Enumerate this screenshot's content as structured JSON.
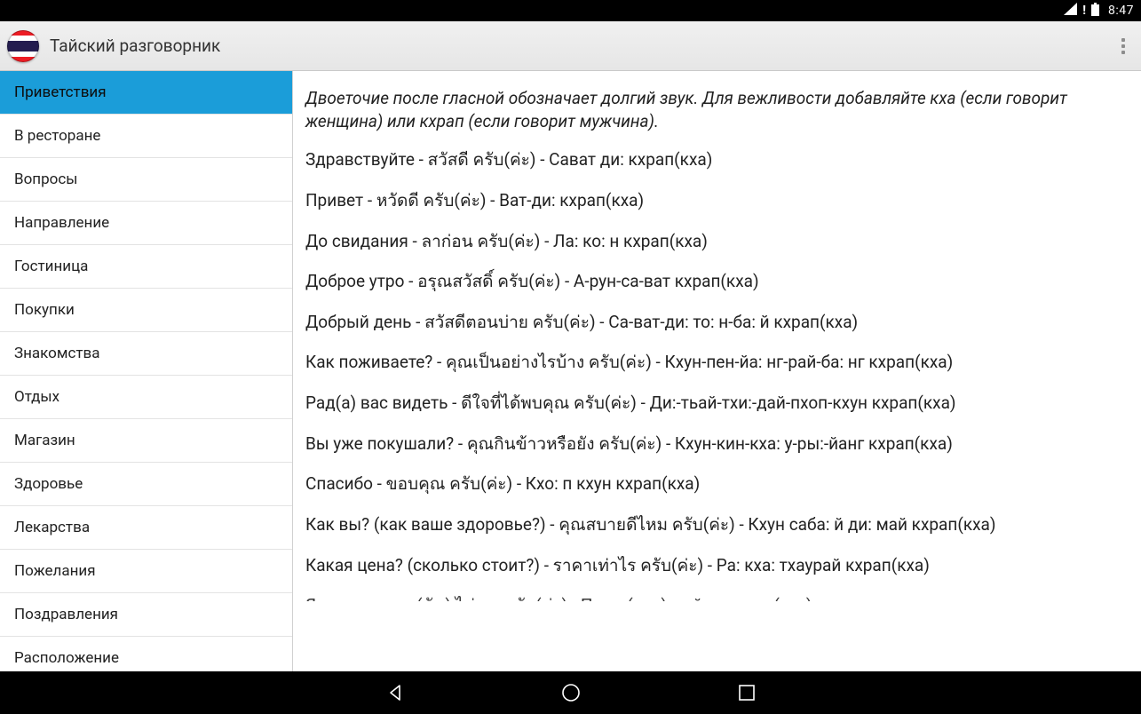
{
  "statusbar": {
    "time": "8:47"
  },
  "actionbar": {
    "title": "Тайский разговорник"
  },
  "sidebar": {
    "selected_index": 0,
    "items": [
      "Приветствия",
      "В ресторане",
      "Вопросы",
      "Направление",
      "Гостиница",
      "Покупки",
      "Знакомства",
      "Отдых",
      "Магазин",
      "Здоровье",
      "Лекарства",
      "Пожелания",
      "Поздравления",
      "Расположение"
    ]
  },
  "content": {
    "intro": "Двоеточие после гласной обозначает долгий звук. Для вежливости добавляйте кха (если говорит женщина) или кхрап (если говорит мужчина).",
    "phrases": [
      "Здравствуйте - สวัสดี ครับ(ค่ะ) - Сават ди: кхрап(кха)",
      "Привет - หวัดดี ครับ(ค่ะ) - Ват-ди: кхрап(кха)",
      "До свидания - ลาก่อน ครับ(ค่ะ) - Ла: ко: н кхрап(кха)",
      "Доброе утро - อรุณสวัสดิ์ ครับ(ค่ะ) - А-рун-са-ват кхрап(кха)",
      "Добрый день - สวัสดีตอนบ่าย ครับ(ค่ะ) - Са-ват-ди: то: н-ба: й кхрап(кха)",
      "Как поживаете? - คุณเป็นอย่างไรบ้าง ครับ(ค่ะ) - Кхун-пен-йа: нг-рай-ба: нг кхрап(кха)",
      "Рад(а) вас видеть - ดีใจที่ได้พบคุณ ครับ(ค่ะ) - Ди:-тьай-тхи:-дай-пхоп-кхун кхрап(кха)",
      "Вы уже покушали? - คุณกินข้าวหรือยัง ครับ(ค่ะ) - Кхун-кин-кха: у-ры:-йанг кхрап(кха)",
      "Спасибо - ขอบคุณ ครับ(ค่ะ) - Кхо: п кхун кхрап(кха)",
      "Как вы? (как ваше здоровье?) - คุณสบายดีไหม ครับ(ค่ะ) - Кхун саба: й ди: май кхрап(кха)",
      "Какая цена? (сколько стоит?) - ราคาเท่าไร ครับ(ค่ะ) - Ра: кха: тхаурай кхрап(кха)",
      "Я не хочу -  ผม (ฉัน) ไม่เอา ครับ(ค่ะ) - Пхом (чан) май ау кхрап(кха)"
    ]
  }
}
